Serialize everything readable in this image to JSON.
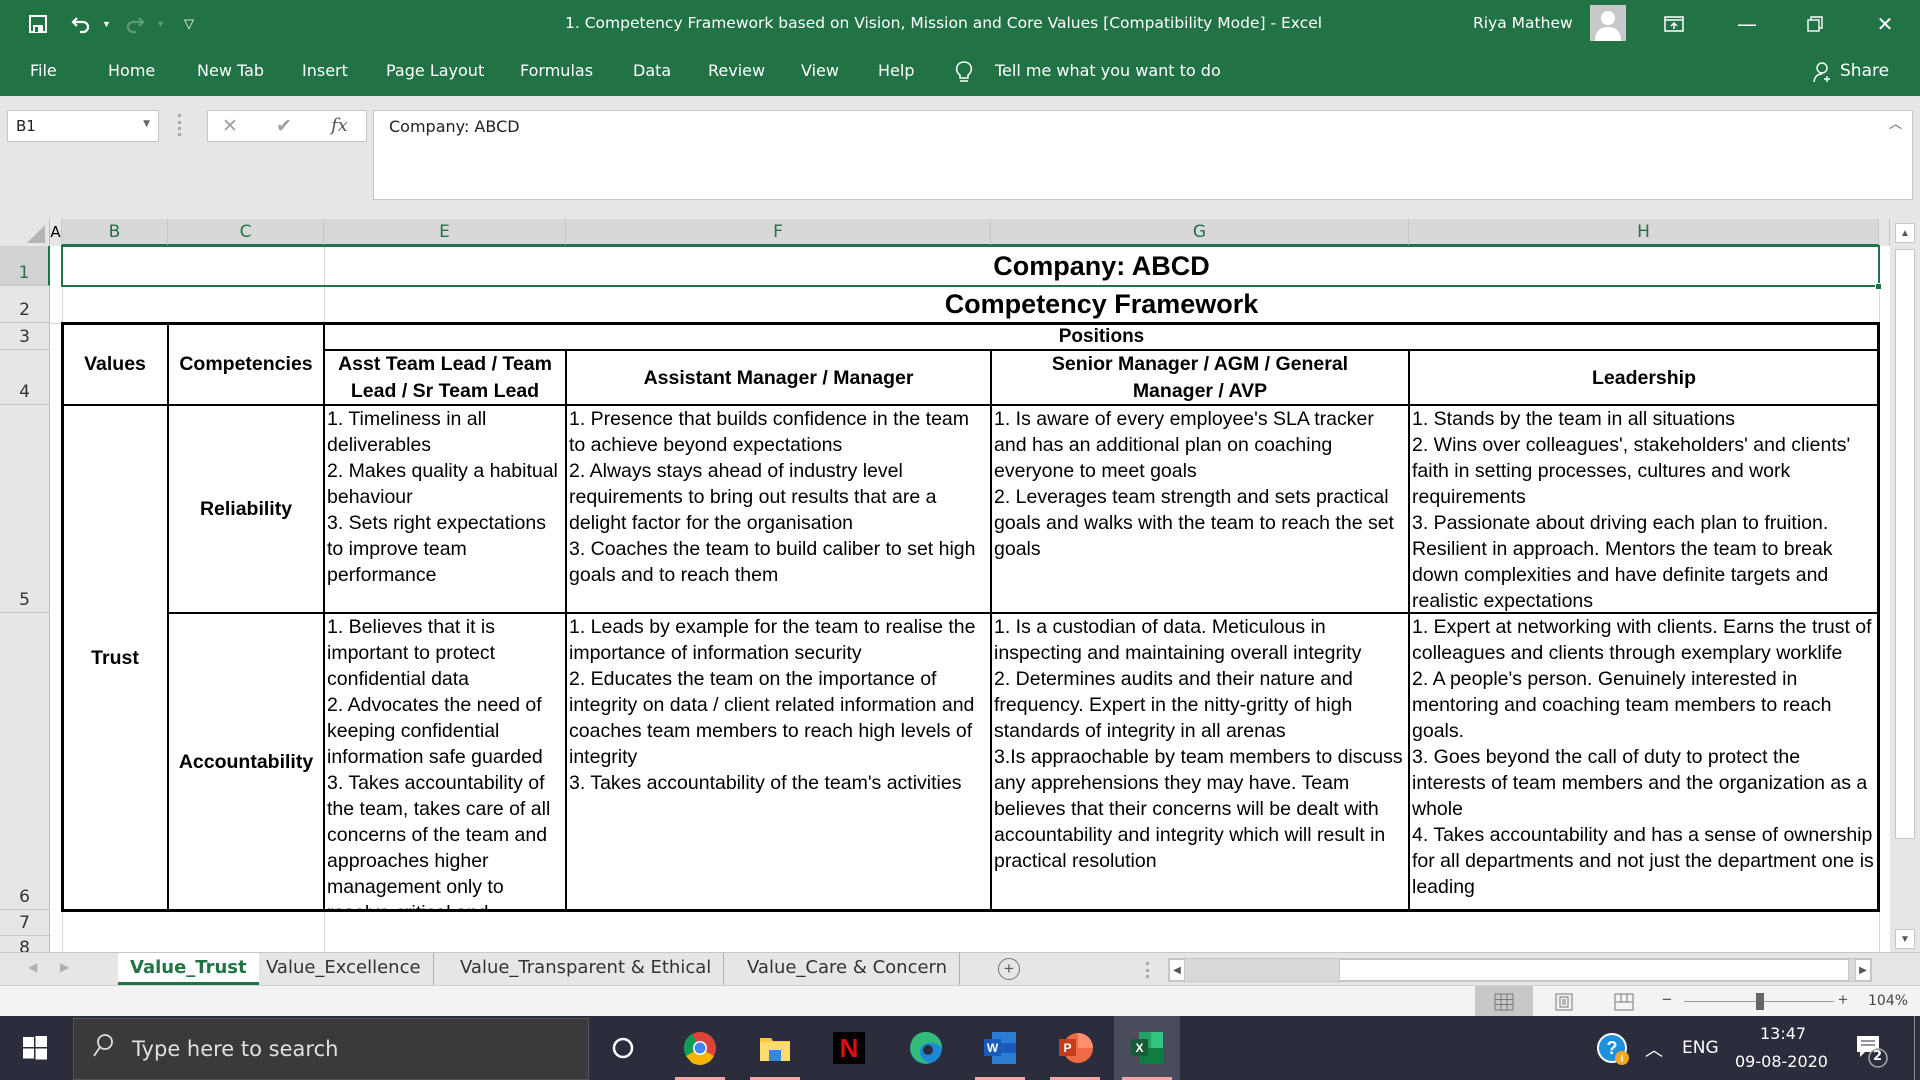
{
  "window": {
    "title": "1. Competency Framework based on Vision, Mission and Core Values  [Compatibility Mode]  -  Excel",
    "user_name": "Riya Mathew"
  },
  "quick_access": {
    "save_icon": "save-icon",
    "undo_icon": "undo-icon",
    "redo_icon": "redo-icon",
    "customize_icon": "customize-qat-icon"
  },
  "ribbon": {
    "tabs": [
      "File",
      "Home",
      "New Tab",
      "Insert",
      "Page Layout",
      "Formulas",
      "Data",
      "Review",
      "View",
      "Help"
    ],
    "tell_me": "Tell me what you want to do",
    "share": "Share"
  },
  "formula_bar": {
    "name_box": "B1",
    "cancel_icon": "cancel-icon",
    "enter_icon": "check-icon",
    "fx_label": "fx",
    "value": "Company: ABCD"
  },
  "grid": {
    "columns": [
      "A",
      "B",
      "C",
      "E",
      "F",
      "G",
      "H"
    ],
    "rows": [
      "1",
      "2",
      "3",
      "4",
      "5",
      "6",
      "7",
      "8"
    ],
    "selected_cell": "B1"
  },
  "sheet": {
    "company": "Company: ABCD",
    "title": "Competency Framework",
    "headers": {
      "values": "Values",
      "competencies": "Competencies",
      "positions": "Positions",
      "position_levels": [
        "Asst Team Lead / Team Lead / Sr Team Lead",
        "Assistant Manager / Manager",
        "Senior Manager / AGM / General Manager / AVP",
        "Leadership"
      ]
    },
    "value_name": "Trust",
    "competencies": [
      {
        "name": "Reliability",
        "cells": [
          "1. Timeliness in all deliverables\n2. Makes quality a habitual behaviour\n3. Sets right expectations to improve team performance",
          "1. Presence that builds confidence in the team to achieve beyond expectations\n2. Always stays ahead of industry level requirements to bring out results that are a delight factor for the organisation\n3. Coaches the team to build caliber to set high goals and to reach them",
          "1. Is aware of every employee's SLA tracker and has an additional plan on coaching everyone to meet goals\n2. Leverages team strength and sets practical goals and walks with the team to reach the set goals",
          "1. Stands by the team in all situations\n2. Wins over colleagues', stakeholders' and clients' faith in setting processes, cultures and work requirements\n3. Passionate about driving each plan to fruition. Resilient in approach. Mentors the team to break down complexities and have definite targets and realistic expectations"
        ]
      },
      {
        "name": "Accountability",
        "cells": [
          "1. Believes that it is important to protect confidential data\n2. Advocates the need of keeping confidential information safe guarded\n3. Takes accountability of the team, takes care of all concerns of the team and approaches higher management only to resolve critical and",
          "1. Leads by example for the team to realise the importance of information security\n2. Educates the team on the importance of integrity on data / client related information and coaches team members to reach high levels of integrity\n3. Takes accountability of the team's activities",
          "1. Is a custodian of data. Meticulous in inspecting and maintaining overall integrity\n2. Determines audits and their nature and frequency. Expert in the nitty-gritty of high standards of integrity in all arenas\n3.Is appraochable by team members to discuss any apprehensions they may have. Team believes that their concerns will be dealt with accountability and integrity which will result in practical resolution",
          "1. Expert at networking with clients. Earns the trust of colleagues and clients through exemplary worklife\n2. A people's person. Genuinely interested in mentoring and coaching team members to reach goals.\n3. Goes beyond the call of duty to protect the interests of team members and the organization as a whole\n4. Takes accountability and has a sense of ownership for all departments and not just the department one is leading"
        ]
      }
    ]
  },
  "sheet_tabs": {
    "tabs": [
      "Value_Trust",
      "Value_Excellence",
      "Value_Transparent & Ethical",
      "Value_Care & Concern"
    ],
    "active": "Value_Trust"
  },
  "status_bar": {
    "zoom_percent": 104,
    "zoom_label": "104%",
    "views": [
      "normal-view-icon",
      "page-layout-view-icon",
      "page-break-preview-icon"
    ],
    "active_view": "normal-view-icon"
  },
  "taskbar": {
    "search_placeholder": "Type here to search",
    "apps": [
      "cortana",
      "chrome",
      "file-explorer",
      "netflix",
      "edge",
      "word",
      "powerpoint",
      "excel"
    ],
    "active_app": "excel",
    "language": "ENG",
    "time": "13:47",
    "date": "09-08-2020",
    "notification_count": "2"
  },
  "colors": {
    "excel_green": "#217346",
    "taskbar": "#2b2d3d"
  }
}
